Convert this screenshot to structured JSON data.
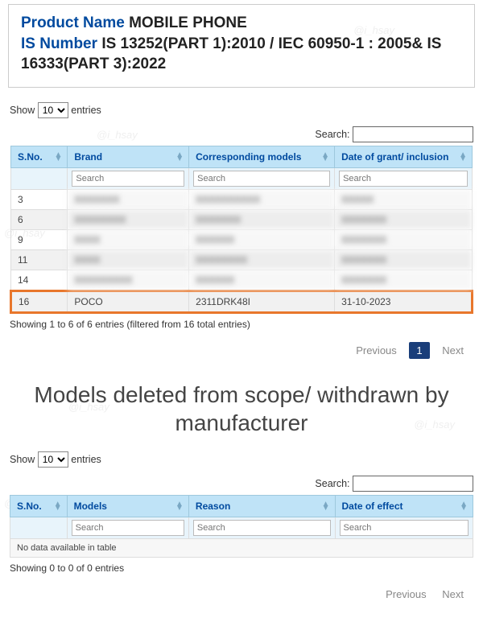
{
  "header": {
    "product_name_label": "Product Name",
    "product_name_value": "MOBILE PHONE",
    "is_number_label": "IS Number",
    "is_number_value": "IS 13252(PART 1):2010 / IEC 60950-1 : 2005& IS 16333(PART 3):2022"
  },
  "watermark": "@i_hsay",
  "table1": {
    "show_label": "Show",
    "entries_label": "entries",
    "length_value": "10",
    "search_label": "Search:",
    "columns": {
      "sno": "S.No.",
      "brand": "Brand",
      "model": "Corresponding models",
      "date": "Date of grant/ inclusion"
    },
    "filter_placeholder": "Search",
    "rows": [
      {
        "sno": "3",
        "brand": "XXXXXXX",
        "model": "XXXXXXXXXX",
        "date": "XXXXX",
        "blur": true
      },
      {
        "sno": "6",
        "brand": "XXXXXXXX",
        "model": "XXXXXXX",
        "date": "XXXXXXX",
        "blur": true
      },
      {
        "sno": "9",
        "brand": "XXXX",
        "model": "XXXXXX",
        "date": "XXXXXXX",
        "blur": true
      },
      {
        "sno": "11",
        "brand": "XXXX",
        "model": "XXXXXXXX",
        "date": "XXXXXXX",
        "blur": true
      },
      {
        "sno": "14",
        "brand": "XXXXXXXXX",
        "model": "XXXXXX",
        "date": "XXXXXXX",
        "blur": true
      },
      {
        "sno": "16",
        "brand": "POCO",
        "model": "2311DRK48I",
        "date": "31-10-2023",
        "blur": false,
        "highlight": true
      }
    ],
    "info": "Showing 1 to 6 of 6 entries (filtered from 16 total entries)",
    "prev": "Previous",
    "page": "1",
    "next": "Next"
  },
  "deleted_title": "Models deleted from scope/ withdrawn by manufacturer",
  "table2": {
    "show_label": "Show",
    "entries_label": "entries",
    "length_value": "10",
    "search_label": "Search:",
    "columns": {
      "sno": "S.No.",
      "models": "Models",
      "reason": "Reason",
      "date": "Date of effect"
    },
    "filter_placeholder": "Search",
    "no_data": "No data available in table",
    "info": "Showing 0 to 0 of 0 entries",
    "prev": "Previous",
    "next": "Next"
  }
}
